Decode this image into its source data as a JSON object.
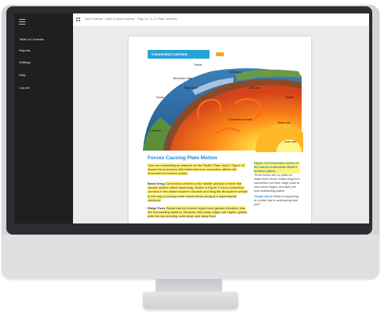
{
  "sidebar": {
    "items": [
      {
        "label": "Table of Contents"
      },
      {
        "label": "Reports"
      },
      {
        "label": "Settings"
      },
      {
        "label": "Help"
      },
      {
        "label": "Log out"
      }
    ]
  },
  "topbar": {
    "breadcrumb": "Earth Science · Earth & Space Science · Page 24, 1c, 1c Plate Tectonics"
  },
  "page": {
    "section_title": "Convection Currents",
    "figure_labels": {
      "trench": "Trench",
      "mid_ocean_ridge": "Mid-ocean ridge",
      "ridge_push": "Ridge push",
      "subduction": "Subduction",
      "slab_pull": "Slab pull",
      "mantle": "Mantle",
      "outer_core": "Outer core",
      "inner_core": "Inner core",
      "convection_currents": "Convection currents",
      "continent": "Continent",
      "trench_2": "Trench"
    },
    "heading": "Forces Causing Plate Motion",
    "para1": "How can something as massive as the Pacific Plate move? Figure 14 shows the processes that determine how convection affects the movement of tectonic plates.",
    "para2_lead": "Basal Drag",
    "para2": "Convection currents in the mantle produce a force that causes motion called basal drag. Notice in Figure 14 how convection currents in the asthenosphere circulate and drag the lithosphere similar to the way a conveyor belt moves items along at a supermarket checkout.",
    "para3_lead": "Ridge Push",
    "para3": "Recall that mid-ocean ridges have greater elevation than the surrounding seafloor. Because mid-ocean ridges are higher, gravity pulls the surrounding rocks down and away from",
    "side_caption": "Figure 14 Convection occurs in the mantle underneath Earth's tectonic plates.",
    "side_text": "Three forces act on plates to make them move: basal drag from convection currents, ridge push at mid-ocean ridges, and slab pull from subducting plates.",
    "visual_check_label": "Visual Check",
    "visual_check_text": "What is happening to a plate that is undergoing slab pull?"
  },
  "colors": {
    "accent": "#26a3d7",
    "highlight": "#fff27a",
    "sidebar_bg": "#1f1f21"
  }
}
